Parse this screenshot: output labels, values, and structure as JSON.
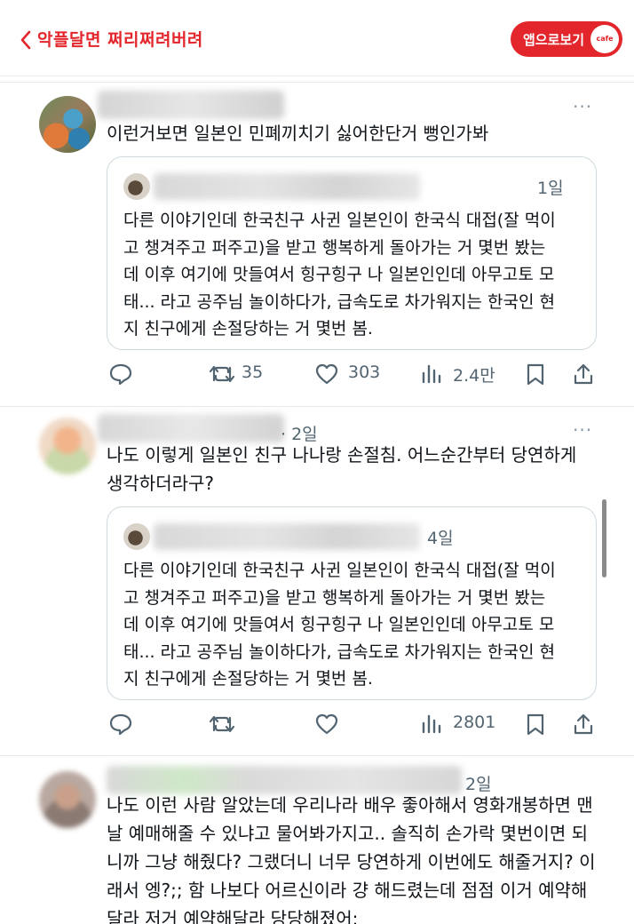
{
  "header": {
    "back_icon": "chevron-left-icon",
    "title": "악플달면 쩌리쩌려버려",
    "app_button": "앱으로보기",
    "app_badge": "cafe",
    "accent_color": "#e2262b"
  },
  "tweets": [
    {
      "time": "",
      "more": "···",
      "text": "이런거보면 일본인 민폐끼치기 싫어한단거 뻥인가봐",
      "quote": {
        "time": "1일",
        "text": "다른 이야기인데 한국친구 사귄 일본인이 한국식 대접(잘 먹이\n고 챙겨주고 퍼주고)을 받고 행복하게 돌아가는 거 몇번 봤는\n데 이후 여기에 맛들여서 힝구힝구 나 일본인인데 아무고토 모\n태... 라고 공주님 놀이하다가, 급속도로 차가워지는 한국인 현\n지 친구에게 손절당하는 거 몇번 봄."
      },
      "actions": {
        "retweets": "35",
        "likes": "303",
        "views": "2.4만"
      }
    },
    {
      "time": "· 2일",
      "more": "···",
      "text": "나도 이렇게 일본인 친구 나나랑 손절침. 어느순간부터 당연하게\n생각하더라구?",
      "quote": {
        "time": "4일",
        "text": "다른 이야기인데 한국친구 사귄 일본인이 한국식 대접(잘 먹이\n고 챙겨주고 퍼주고)을 받고 행복하게 돌아가는 거 몇번 봤는\n데 이후 여기에 맛들여서 힝구힝구 나 일본인인데 아무고토 모\n태... 라고 공주님 놀이하다가, 급속도로 차가워지는 한국인 현\n지 친구에게 손절당하는 거 몇번 봄."
      },
      "actions": {
        "retweets": "",
        "likes": "",
        "views": "2801"
      }
    },
    {
      "time": "2일",
      "more": "···",
      "text": "나도 이런 사람 알았는데 우리나라 배우 좋아해서 영화개봉하면 맨\n날 예매해줄 수 있냐고 물어봐가지고.. 솔직히 손가락 몇번이면 되\n니까 그냥 해줬다? 그랬더니 너무 당연하게 이번에도 해줄거지? 이\n래서 엥?;; 함 나보다 어르신이라 걍 해드렸는데 점점 이거 예약해\n달라 저거 예약해달라 당당해졌어;"
    }
  ]
}
